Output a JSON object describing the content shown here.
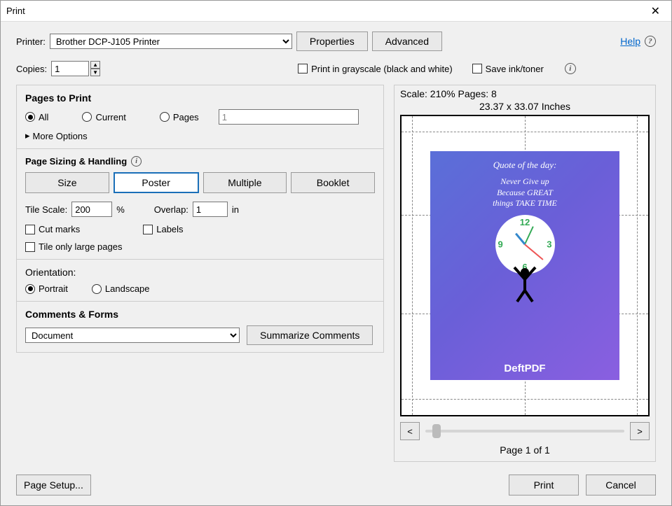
{
  "window": {
    "title": "Print"
  },
  "header": {
    "printer_label": "Printer:",
    "printer_value": "Brother DCP-J105 Printer",
    "properties_btn": "Properties",
    "advanced_btn": "Advanced",
    "help_link": "Help",
    "copies_label": "Copies:",
    "copies_value": "1",
    "grayscale_label": "Print in grayscale (black and white)",
    "save_ink_label": "Save ink/toner"
  },
  "pages_to_print": {
    "title": "Pages to Print",
    "all": "All",
    "current": "Current",
    "pages": "Pages",
    "pages_value": "1",
    "more_options": "More Options"
  },
  "sizing": {
    "title": "Page Sizing & Handling",
    "tabs": {
      "size": "Size",
      "poster": "Poster",
      "multiple": "Multiple",
      "booklet": "Booklet"
    },
    "tile_scale_label": "Tile Scale:",
    "tile_scale_value": "200",
    "tile_scale_unit": "%",
    "overlap_label": "Overlap:",
    "overlap_value": "1",
    "overlap_unit": "in",
    "cut_marks": "Cut marks",
    "labels": "Labels",
    "tile_large": "Tile only large pages"
  },
  "orientation": {
    "title": "Orientation:",
    "portrait": "Portrait",
    "landscape": "Landscape"
  },
  "comments": {
    "title": "Comments & Forms",
    "value": "Document",
    "summarize": "Summarize Comments"
  },
  "preview": {
    "meta": "Scale: 210% Pages: 8",
    "dims": "23.37 x 33.07 Inches",
    "poster_quote_title": "Quote of the day:",
    "poster_quote_body": "Never Give up\nBecause GREAT\nthings TAKE TIME",
    "brand": "DeftPDF",
    "page_info": "Page 1 of 1",
    "prev": "<",
    "next": ">"
  },
  "footer": {
    "page_setup": "Page Setup...",
    "print": "Print",
    "cancel": "Cancel"
  }
}
